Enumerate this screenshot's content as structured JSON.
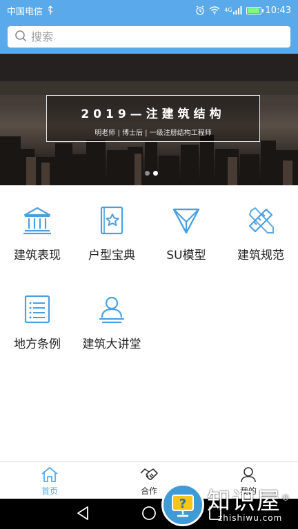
{
  "status_bar": {
    "carrier": "中国电信",
    "usb_icon": "usb-icon",
    "alarm_icon": "alarm-icon",
    "wifi_icon": "wifi-icon",
    "network": "4G",
    "battery_icon": "battery-charging-icon",
    "time": "10:43"
  },
  "search": {
    "placeholder": "搜索",
    "icon": "search-icon"
  },
  "banner": {
    "title": "2019—注建筑结构",
    "subtitle": "明老师 | 博士后 | 一级注册结构工程师",
    "slide_count": 2,
    "active_slide": 2
  },
  "categories": [
    {
      "label": "建筑表现",
      "icon": "building-columns-icon"
    },
    {
      "label": "户型宝典",
      "icon": "star-book-icon"
    },
    {
      "label": "SU模型",
      "icon": "triangle-model-icon"
    },
    {
      "label": "建筑规范",
      "icon": "ruler-pencil-icon"
    },
    {
      "label": "地方条例",
      "icon": "list-document-icon"
    },
    {
      "label": "建筑大讲堂",
      "icon": "lecturer-person-icon"
    }
  ],
  "tabbar": {
    "tabs": [
      {
        "label": "首页",
        "icon": "home-icon",
        "active": true
      },
      {
        "label": "合作",
        "icon": "handshake-icon",
        "active": false
      },
      {
        "label": "我的",
        "icon": "user-icon",
        "active": false
      }
    ]
  },
  "system_nav": {
    "back": "back-icon",
    "home": "home-circle-icon",
    "recent": "recent-apps-icon"
  },
  "watermark": {
    "text": "知识屋",
    "registered": "®",
    "url": "zhishiwu.com",
    "badge_icon": "question-monitor-icon"
  },
  "colors": {
    "accent": "#5aa9ea",
    "icon_blue": "#4a9fe0",
    "text": "#222222"
  }
}
